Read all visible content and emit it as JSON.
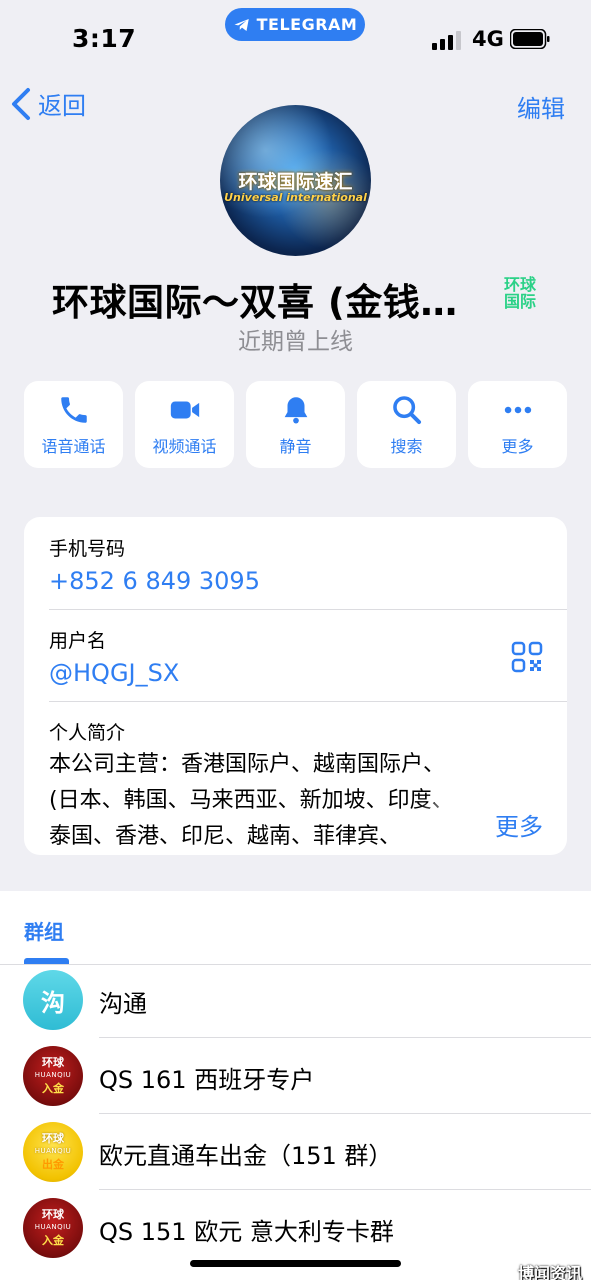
{
  "status_bar": {
    "time": "3:17",
    "app_pill": "TELEGRAM",
    "network": "4G"
  },
  "nav": {
    "back_label": "返回",
    "edit_label": "编辑"
  },
  "avatar": {
    "logo_cn": "环球国际速汇",
    "logo_en": "Universal international"
  },
  "profile": {
    "name": "环球国际～双喜 (金钱…",
    "badge_line1": "环球",
    "badge_line2": "国际",
    "last_seen": "近期曾上线"
  },
  "actions": [
    {
      "label": "语音通话",
      "icon": "phone-icon"
    },
    {
      "label": "视频通话",
      "icon": "video-icon"
    },
    {
      "label": "静音",
      "icon": "bell-icon"
    },
    {
      "label": "搜索",
      "icon": "search-icon"
    },
    {
      "label": "更多",
      "icon": "more-icon"
    }
  ],
  "info": {
    "phone_label": "手机号码",
    "phone_value": "+852 6 849 3095",
    "username_label": "用户名",
    "username_value": "@HQGJ_SX",
    "bio_label": "个人简介",
    "bio_text": "本公司主营：香港国际户、越南国际户、\n(日本、韩国、马来西亚、新加坡、印度、\n泰国、香港、印尼、越南、菲律宾、",
    "more_label": "更多"
  },
  "groups": {
    "tab_label": "群组",
    "items": [
      {
        "name": "沟通",
        "avatar_type": "teal",
        "avatar_text": "沟"
      },
      {
        "name": "QS 161 西班牙专户",
        "avatar_type": "red",
        "avatar_top": "环球",
        "avatar_mid": "HUANQIU",
        "avatar_bot": "入金"
      },
      {
        "name": "欧元直通车出金（151 群）",
        "avatar_type": "gold",
        "avatar_top": "环球",
        "avatar_mid": "HUANQIU",
        "avatar_bot": "出金"
      },
      {
        "name": "QS 151 欧元 意大利专卡群",
        "avatar_type": "red",
        "avatar_top": "环球",
        "avatar_mid": "HUANQIU",
        "avatar_bot": "入金"
      }
    ]
  },
  "watermark": "博闻资讯",
  "colors": {
    "accent": "#2f7ef2",
    "background": "#efeff4",
    "badge": "#2bd187"
  }
}
